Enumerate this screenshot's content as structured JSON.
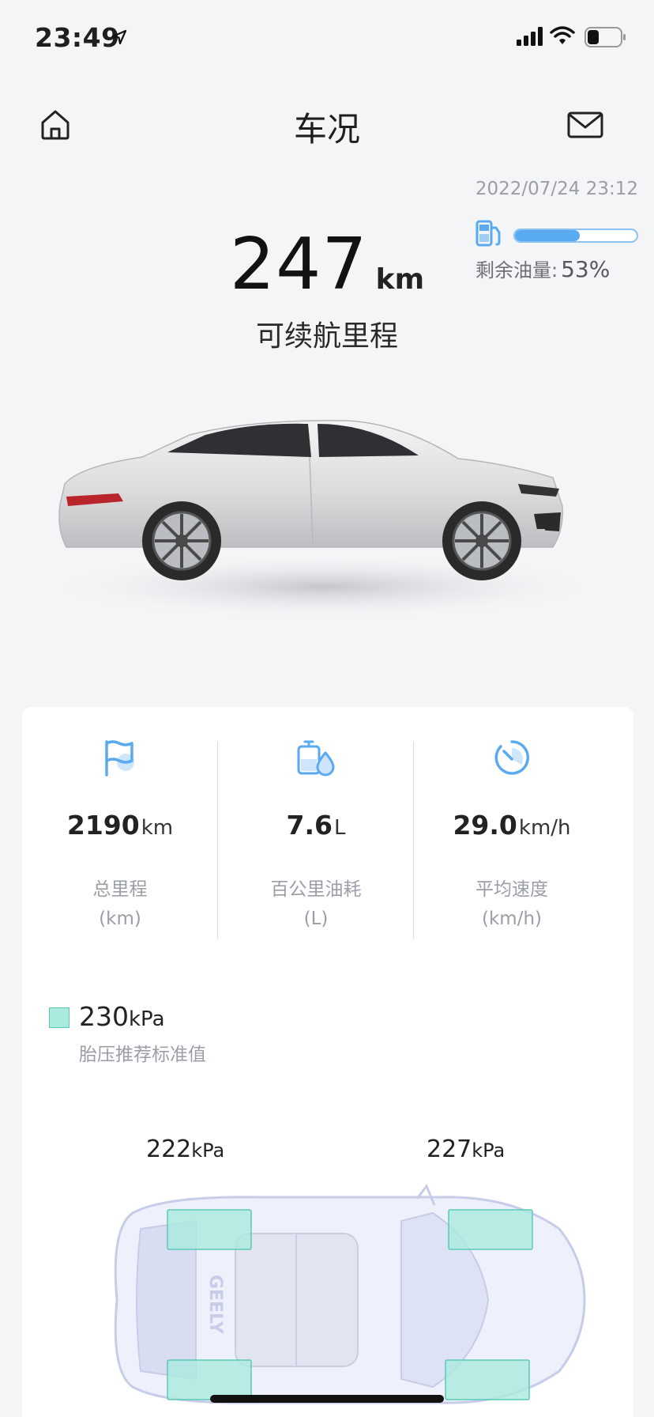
{
  "status_bar": {
    "time": "23:49",
    "icons": [
      "location-arrow-icon",
      "cellular-signal-icon",
      "wifi-icon",
      "battery-icon"
    ]
  },
  "nav": {
    "title": "车况",
    "left_icon": "home-icon",
    "right_icon": "mail-icon"
  },
  "updated_time": "2022/07/24 23:12",
  "fuel": {
    "icon": "fuel-pump-icon",
    "label": "剩余油量:",
    "value": "53%",
    "level": 0.53,
    "fill_color": "#5aaaf1"
  },
  "range": {
    "value": "247",
    "unit": "km",
    "label": "可续航里程"
  },
  "car_image": "car-side-view",
  "stats": [
    {
      "icon": "flag-icon",
      "value": "2190",
      "unit": "km",
      "label": "总里程",
      "sublabel": "(km)"
    },
    {
      "icon": "oil-drop-icon",
      "value": "7.6",
      "unit": "L",
      "label": "百公里油耗",
      "sublabel": "(L)"
    },
    {
      "icon": "speedometer-icon",
      "value": "29.0",
      "unit": "km/h",
      "label": "平均速度",
      "sublabel": "(km/h)"
    }
  ],
  "tyre": {
    "standard": {
      "value": "230",
      "unit": "kPa",
      "label": "胎压推荐标准值",
      "color": "#aaeadf"
    },
    "front_left": {
      "value": "222",
      "unit": "kPa"
    },
    "front_right": {
      "value": "227",
      "unit": "kPa"
    },
    "car_badge": "GEELY"
  },
  "colors": {
    "accent": "#5aaaf1",
    "tyre": "#aaeadf",
    "background": "#f4f5f7"
  }
}
